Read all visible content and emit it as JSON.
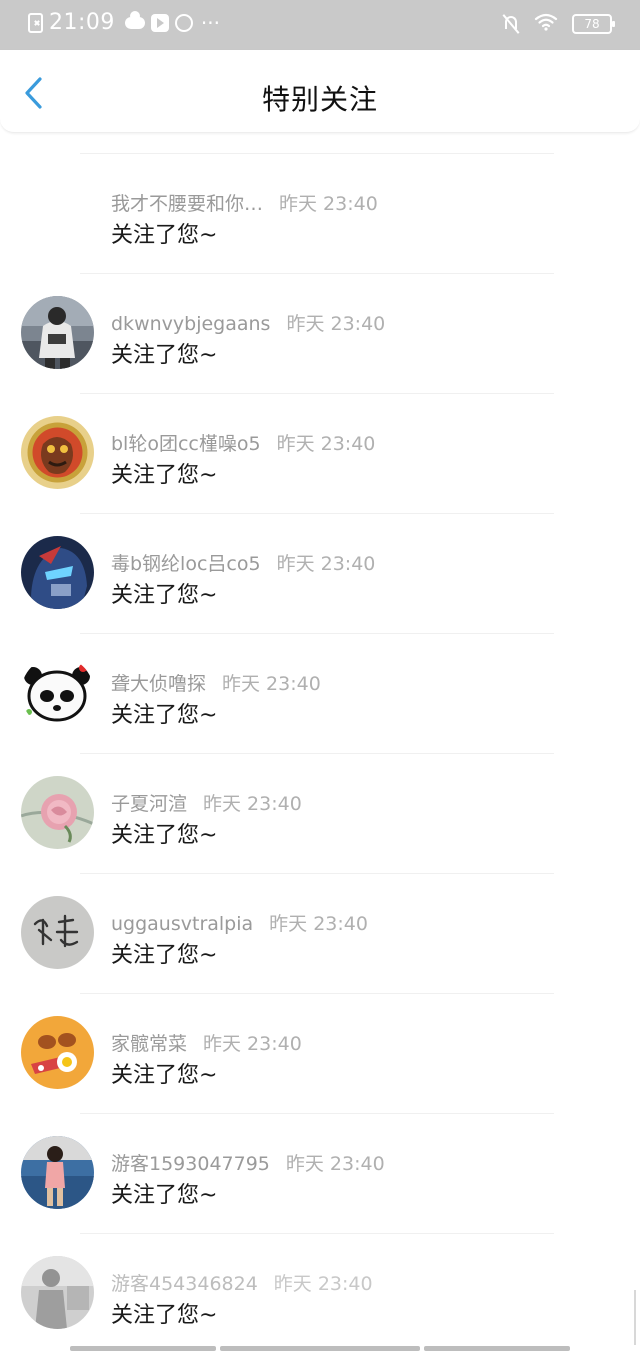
{
  "status_bar": {
    "time": "21:09",
    "battery": "78",
    "overflow_dots": "···",
    "icons": [
      "notification-x-icon",
      "cloud-icon",
      "play-icon",
      "sync-icon",
      "bell-muted-icon",
      "wifi-icon",
      "battery-icon"
    ]
  },
  "header": {
    "title": "特别关注",
    "back_icon": "chevron-left-icon",
    "accent_color": "#3a9bdc"
  },
  "items": [
    {
      "name": "我才不腰要和你…",
      "time": "昨天 23:40",
      "message": "关注了您~"
    },
    {
      "name": "dkwnvybjegaans",
      "time": "昨天 23:40",
      "message": "关注了您~"
    },
    {
      "name": "bl轮o团cc槿噪o5",
      "time": "昨天 23:40",
      "message": "关注了您~"
    },
    {
      "name": "毒b钢纶loc吕co5",
      "time": "昨天 23:40",
      "message": "关注了您~"
    },
    {
      "name": "聋大侦噜探",
      "time": "昨天 23:40",
      "message": "关注了您~"
    },
    {
      "name": "子夏河渲",
      "time": "昨天 23:40",
      "message": "关注了您~"
    },
    {
      "name": "uggausvtralpia",
      "time": "昨天 23:40",
      "message": "关注了您~"
    },
    {
      "name": "家髋常菜",
      "time": "昨天 23:40",
      "message": "关注了您~"
    },
    {
      "name": "游客1593047795",
      "time": "昨天 23:40",
      "message": "关注了您~"
    },
    {
      "name": "游客454346824",
      "time": "昨天 23:40",
      "message": "关注了您~"
    }
  ]
}
